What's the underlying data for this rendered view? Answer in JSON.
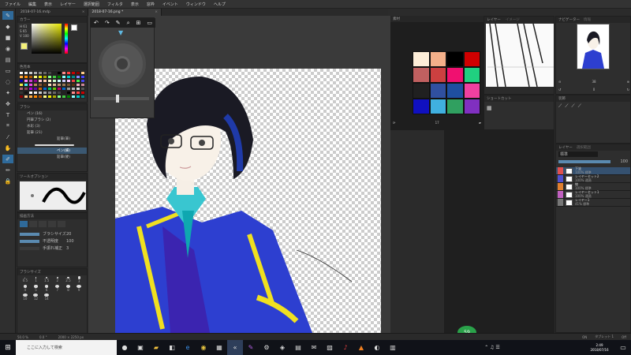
{
  "app": {
    "menu": [
      "ファイル",
      "編集",
      "表示",
      "レイヤー",
      "選択範囲",
      "フィルタ",
      "表示",
      "窓枠",
      "イベント",
      "ウィンドウ",
      "ヘルプ"
    ]
  },
  "tabs": [
    {
      "label": "2018-07-16.mdp",
      "close": "×"
    },
    {
      "label": "2018-07-16.png *",
      "close": "×"
    }
  ],
  "tools": [
    "brush-icon",
    "eraser-icon",
    "rectangle-icon",
    "fill-icon",
    "gradient-icon",
    "select-icon",
    "lasso-icon",
    "wand-icon",
    "move-icon",
    "text-icon",
    "crop-icon",
    "eyedropper-icon",
    "hand-icon",
    "pen-icon",
    "pencil-icon",
    "lock-icon"
  ],
  "panels": {
    "color": {
      "title": "カラー",
      "hsv": [
        "H",
        "S",
        "V"
      ],
      "hsv_values": [
        "61",
        "65",
        "100"
      ],
      "swatch_color": "#f4f07a"
    },
    "palette": {
      "title": "色見本"
    },
    "brush": {
      "title": "ブラシ",
      "groups": [
        "ペン (16)",
        "円筆ブラシ (2)",
        "水彩 (3)",
        "鉛筆 (21)"
      ],
      "items": [
        "鉛筆(筆)",
        "ペン(細)",
        "鉛筆(硬)"
      ]
    },
    "tool_option": {
      "title": "ツールオプション"
    },
    "brush_shape": {
      "title": "描画方法",
      "props": [
        {
          "label": "ブラシサイズ",
          "value": "20"
        },
        {
          "label": "不透明度",
          "value": "100"
        },
        {
          "label": "手振れ補正",
          "value": "3"
        }
      ]
    },
    "brush_size": {
      "title": "ブラシサイズ",
      "sizes": [
        "0.5",
        "1",
        "1.5",
        "2",
        "2.5",
        "3",
        "4",
        "5",
        "6",
        "7",
        "8",
        "9",
        "10",
        "12",
        "14"
      ]
    },
    "material": {
      "title": "素材"
    },
    "preview": {
      "title": "レイヤー",
      "subtitle": "イメージ"
    },
    "shortcut": {
      "title": "ショートカット"
    },
    "navigator": {
      "title": "ナビゲーター",
      "sub": "情報",
      "zoom": "38",
      "angle": "0"
    },
    "deco": {
      "title": "装飾"
    },
    "layer": {
      "title": "レイヤー",
      "sub": "選択範囲",
      "blend": "標準",
      "opacity": "100",
      "items": [
        {
          "name": "下塗",
          "info": "100% 標準",
          "color": "#e05050"
        },
        {
          "name": "レイヤーセット2",
          "info": "100% 通過",
          "color": "#5050d0"
        },
        {
          "name": "線",
          "info": "100% 標準",
          "color": "#e08030"
        },
        {
          "name": "レイヤーセット1",
          "info": "100% 通過",
          "color": "#c060c0"
        },
        {
          "name": "レイヤー1",
          "info": "41% 標準",
          "color": "#777777"
        }
      ]
    }
  },
  "status": {
    "zoom": "50.0 %",
    "angle": "0.0 °",
    "size": "2000 × 2250 px",
    "zoom_right": "17",
    "fps": "59",
    "net_up": "0K/s",
    "net_down": "0K/s",
    "mem": "ON",
    "tablet": "タブレット 1",
    "cursor": "Off"
  },
  "taskbar": {
    "search": "ここに入力して検索",
    "time": "2:49",
    "date": "2018/07/16"
  }
}
